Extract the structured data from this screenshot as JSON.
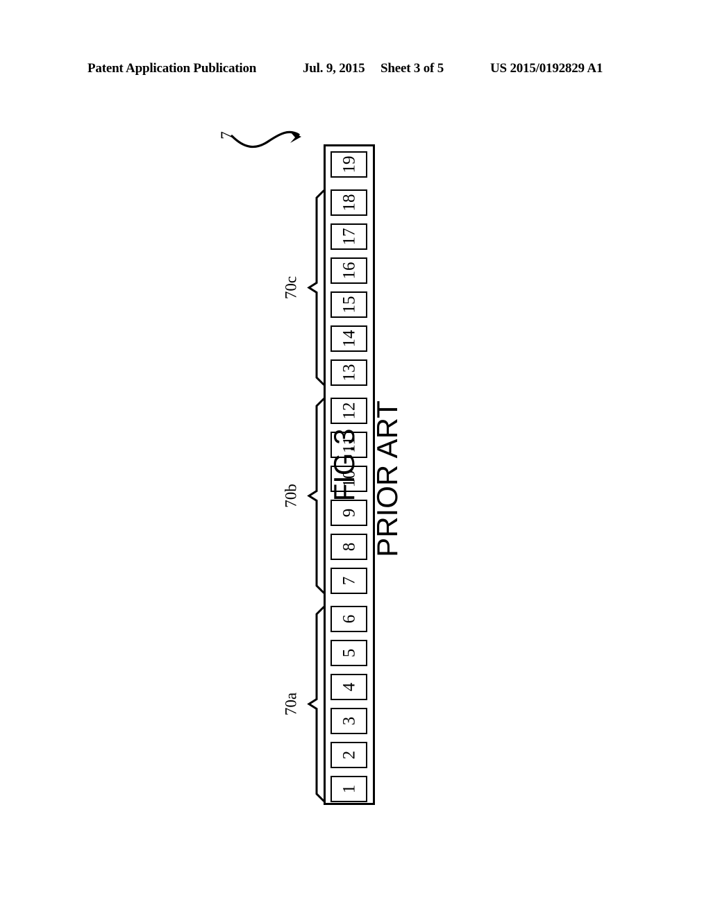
{
  "header": {
    "publication": "Patent Application Publication",
    "date": "Jul. 9, 2015",
    "sheet": "Sheet 3 of 5",
    "patent_number": "US 2015/0192829 A1"
  },
  "figure": {
    "caption_number": "FIG.3",
    "caption_note": "PRIOR ART",
    "reference_numeral": "7",
    "container_label": "7",
    "cells": [
      {
        "label": "19"
      },
      {
        "label": "18"
      },
      {
        "label": "17"
      },
      {
        "label": "16"
      },
      {
        "label": "15"
      },
      {
        "label": "14"
      },
      {
        "label": "13"
      },
      {
        "label": "12"
      },
      {
        "label": "11"
      },
      {
        "label": "10"
      },
      {
        "label": "9"
      },
      {
        "label": "8"
      },
      {
        "label": "7"
      },
      {
        "label": "6"
      },
      {
        "label": "5"
      },
      {
        "label": "4"
      },
      {
        "label": "3"
      },
      {
        "label": "2"
      },
      {
        "label": "1"
      }
    ],
    "groups": [
      {
        "label": "70c",
        "first_cell": "18",
        "last_cell": "13"
      },
      {
        "label": "70b",
        "first_cell": "12",
        "last_cell": "7"
      },
      {
        "label": "70a",
        "first_cell": "6",
        "last_cell": "1"
      }
    ]
  },
  "colors": {
    "ink": "#000000",
    "paper": "#ffffff"
  }
}
